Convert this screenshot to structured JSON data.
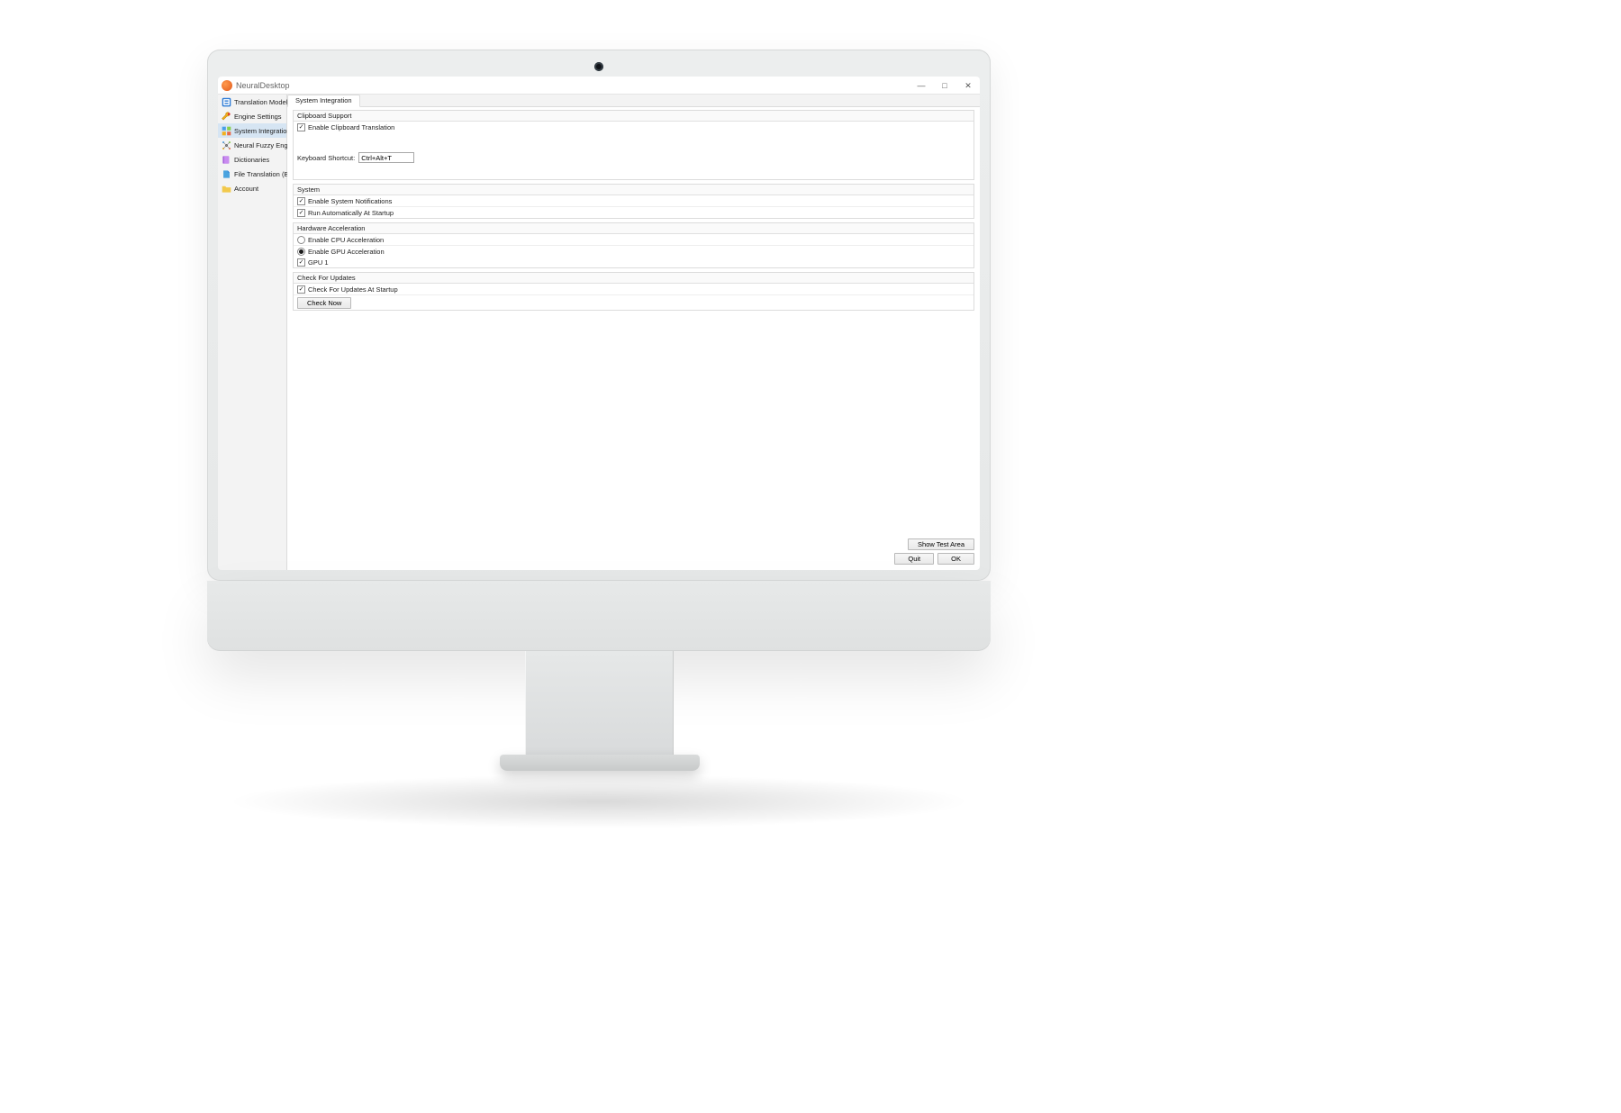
{
  "title": "NeuralDesktop",
  "window_controls": {
    "min": "—",
    "max": "□",
    "close": "✕"
  },
  "sidebar": {
    "items": [
      {
        "label": "Translation Models"
      },
      {
        "label": "Engine Settings"
      },
      {
        "label": "System Integration"
      },
      {
        "label": "Neural Fuzzy Engine"
      },
      {
        "label": "Dictionaries"
      },
      {
        "label": "File Translation (Beta)"
      },
      {
        "label": "Account"
      }
    ]
  },
  "tab": {
    "label": "System Integration"
  },
  "clipboard": {
    "header": "Clipboard Support",
    "enable_label": "Enable Clipboard Translation",
    "shortcut_label": "Keyboard Shortcut:",
    "shortcut_value": "Ctrl+Alt+T"
  },
  "system": {
    "header": "System",
    "notifications_label": "Enable System Notifications",
    "autostart_label": "Run Automatically At Startup"
  },
  "hwaccel": {
    "header": "Hardware Acceleration",
    "cpu_label": "Enable CPU Acceleration",
    "gpu_label": "Enable GPU Acceleration",
    "gpu1_label": "GPU 1"
  },
  "updates": {
    "header": "Check For Updates",
    "startup_label": "Check For Updates At Startup",
    "checknow_label": "Check Now"
  },
  "footer": {
    "show_test_area": "Show Test Area",
    "quit": "Quit",
    "ok": "OK"
  }
}
